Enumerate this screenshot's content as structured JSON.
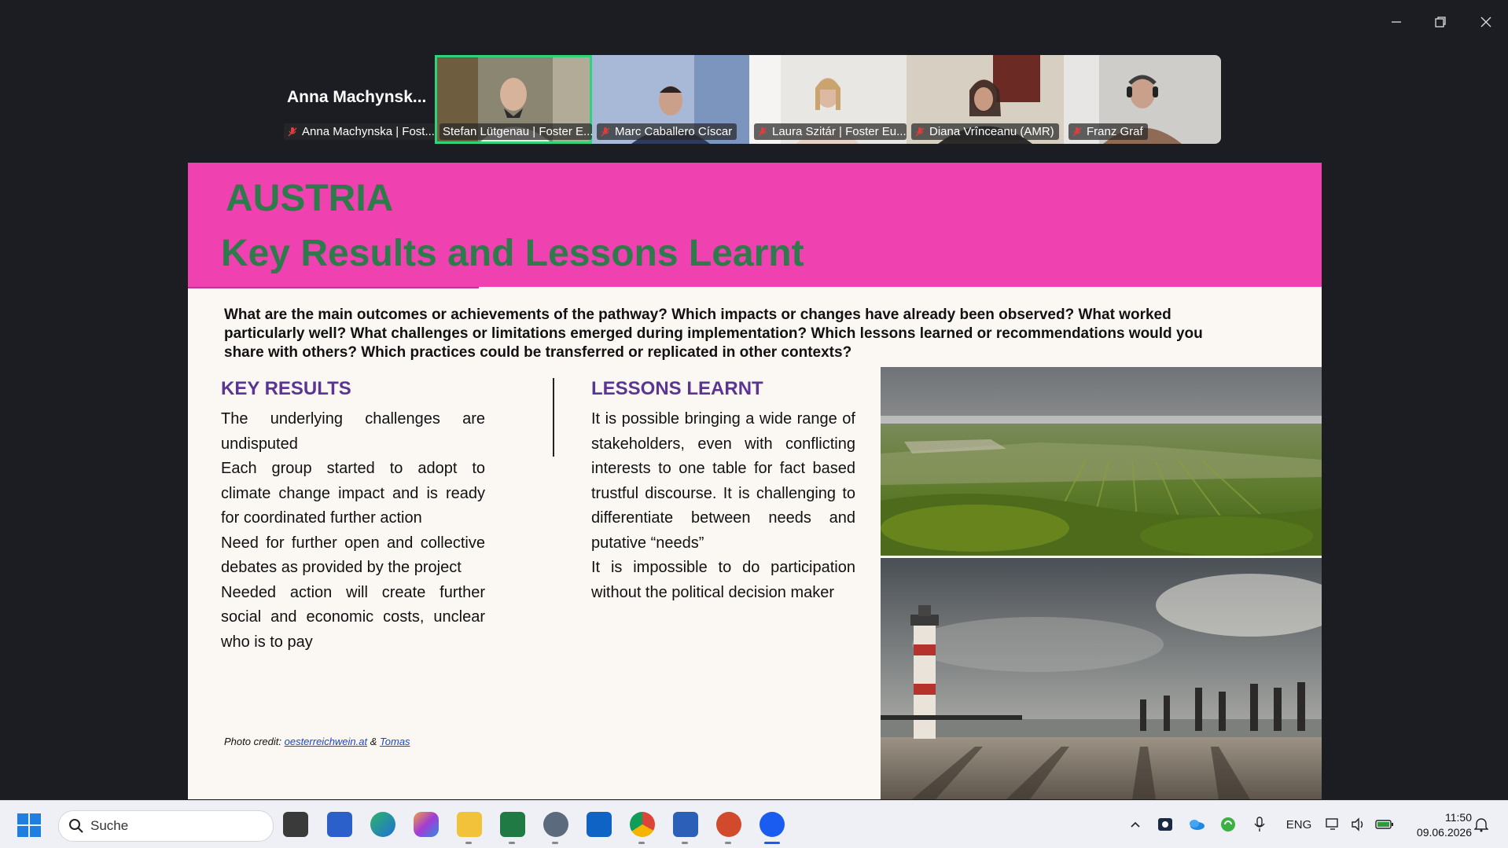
{
  "window": {
    "controls": [
      "minimize-icon",
      "restore-icon",
      "close-icon"
    ]
  },
  "meeting": {
    "active_speaker_name": "Anna  Machynsk...",
    "participants": [
      {
        "label": "Anna Machynska | Fost..."
      },
      {
        "label": "Stefan Lütgenau | Foster E...",
        "active": true
      },
      {
        "label": "Marc Caballero Císcar"
      },
      {
        "label": "Laura Szitár | Foster Eu..."
      },
      {
        "label": "Diana Vrînceanu (AMR)"
      },
      {
        "label": "Franz Graf"
      }
    ]
  },
  "slide": {
    "country": "AUSTRIA",
    "headline": "Key Results and Lessons Learnt",
    "question": "What are the main outcomes or achievements of the pathway? Which impacts or changes have already been observed? What worked particularly well? What challenges or limitations emerged during implementation? Which lessons learned or recommendations would you share with others? Which practices could be transferred or replicated in other contexts?",
    "key_results": {
      "title": "KEY RESULTS",
      "items": [
        "The underlying challenges are undisputed",
        "Each group started to adopt to climate change impact and is ready for coordinated further action",
        "Need for further open and collective debates as provided by the project",
        "Needed action will create further social and economic costs, unclear who is to pay"
      ]
    },
    "lessons_learnt": {
      "title": "LESSONS LEARNT",
      "items": [
        "It is possible bringing a wide range of stakeholders, even with conflicting interests to one table for fact based trustful discourse. It is challenging to differentiate between needs and putative “needs”",
        "It is impossible to do participation without the political decision maker"
      ]
    },
    "credit": {
      "prefix": "Photo credit: ",
      "link1": "oesterreichwein.at",
      "sep": " & ",
      "link2": "Tomas"
    }
  },
  "taskbar": {
    "search_label": "Suche",
    "language": "ENG",
    "time": "11:50",
    "date": "09.06.2026",
    "apps": [
      "task-view-icon",
      "store-icon",
      "edge-icon",
      "copilot-icon",
      "file-explorer-icon",
      "excel-icon",
      "settings-icon",
      "outlook-icon",
      "chrome-icon",
      "word-icon",
      "powerpoint-icon",
      "zoom-icon"
    ]
  },
  "colors": {
    "header_pink": "#f041b1",
    "headline_green": "#2d7a4a",
    "column_title_purple": "#5b3594",
    "active_speaker_border": "#2ed37c"
  }
}
